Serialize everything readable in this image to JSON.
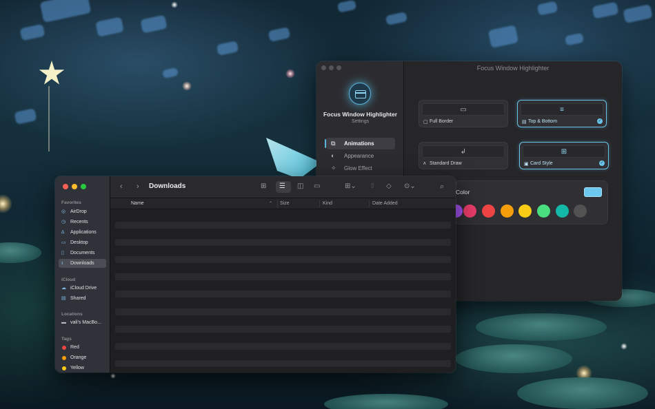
{
  "settings_window": {
    "title": "Focus Window Highlighter",
    "app_name": "Focus Window Highlighter",
    "app_subtitle": "Settings",
    "nav": [
      {
        "label": "Animations",
        "icon": "layers-icon",
        "active": true
      },
      {
        "label": "Appearance",
        "icon": "palette-icon",
        "active": false
      },
      {
        "label": "Glow Effect",
        "icon": "sparkle-icon",
        "active": false
      }
    ],
    "styles": [
      {
        "label": "Full Border",
        "icon": "square-icon",
        "selected": false
      },
      {
        "label": "Top & Bottom",
        "icon": "top-bottom-icon",
        "selected": true
      },
      {
        "label": "Standard Draw",
        "icon": "draw-icon",
        "selected": false
      },
      {
        "label": "Card Style",
        "icon": "card-icon",
        "selected": true
      }
    ],
    "color_section": {
      "label": "Color",
      "current_color": "#6cc8ee",
      "swatches": [
        "#a855f7",
        "#ec3d6b",
        "#ef4444",
        "#f59e0b",
        "#facc15",
        "#4ade80",
        "#14b8a6",
        "#525252"
      ]
    }
  },
  "finder_window": {
    "title": "Downloads",
    "sidebar": {
      "favorites_label": "Favorites",
      "favorites": [
        {
          "label": "AirDrop",
          "icon": "airdrop-icon"
        },
        {
          "label": "Recents",
          "icon": "clock-icon"
        },
        {
          "label": "Applications",
          "icon": "applications-icon"
        },
        {
          "label": "Desktop",
          "icon": "desktop-icon"
        },
        {
          "label": "Documents",
          "icon": "document-icon"
        },
        {
          "label": "Downloads",
          "icon": "download-icon",
          "active": true
        }
      ],
      "icloud_label": "iCloud",
      "icloud": [
        {
          "label": "iCloud Drive",
          "icon": "cloud-icon"
        },
        {
          "label": "Shared",
          "icon": "shared-folder-icon"
        }
      ],
      "locations_label": "Locations",
      "locations": [
        {
          "label": "vali's MacBo...",
          "icon": "laptop-icon"
        }
      ],
      "tags_label": "Tags",
      "tags": [
        {
          "label": "Red",
          "color": "#ef4444"
        },
        {
          "label": "Orange",
          "color": "#f59e0b"
        },
        {
          "label": "Yellow",
          "color": "#facc15"
        }
      ]
    },
    "columns": [
      "Name",
      "Size",
      "Kind",
      "Date Added"
    ]
  }
}
